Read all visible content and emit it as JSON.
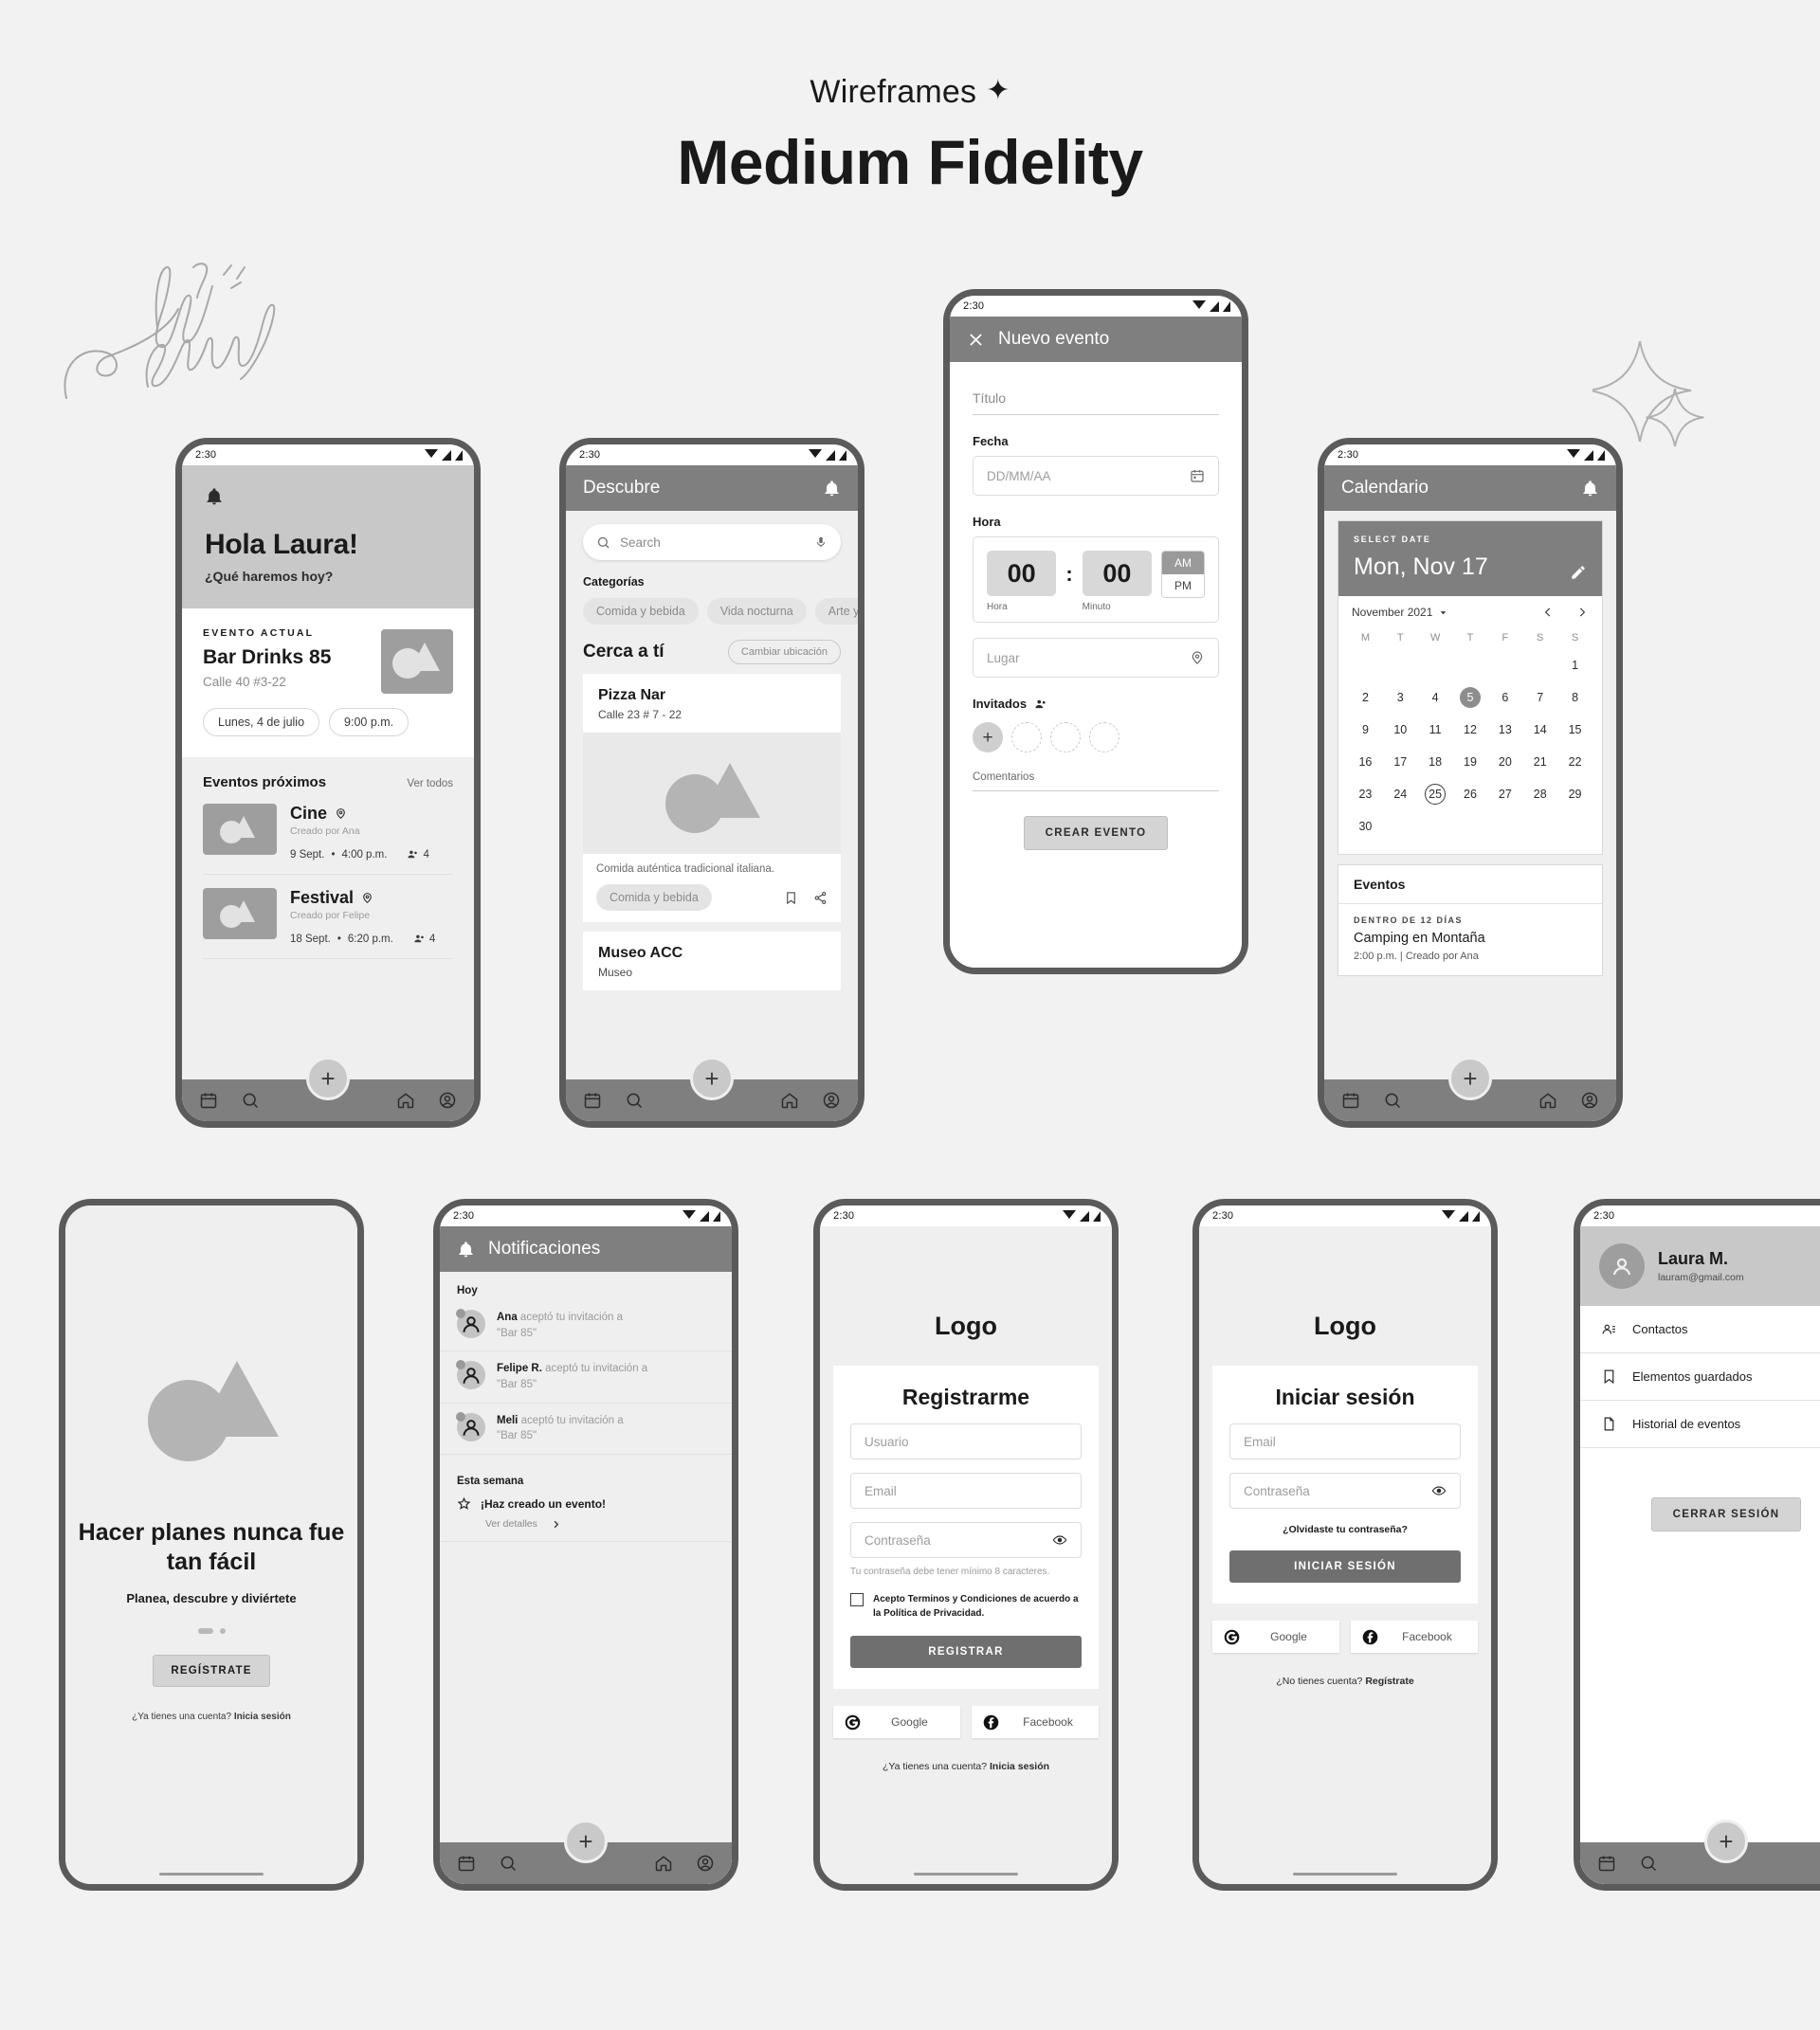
{
  "header": {
    "subtitle": "Wireframes",
    "star": "✦",
    "title": "Medium Fidelity"
  },
  "annotations": {
    "scribble": "home eventos"
  },
  "common": {
    "status_time": "2:30",
    "fab_label": "+",
    "nav": [
      "calendar-icon",
      "search-icon",
      "home-icon",
      "profile-icon"
    ]
  },
  "phone_home": {
    "bell": "bell-icon",
    "greeting": "Hola Laura!",
    "subgreeting": "¿Qué haremos hoy?",
    "current_event": {
      "kicker": "EVENTO ACTUAL",
      "title": "Bar Drinks 85",
      "address": "Calle 40 #3-22",
      "chips": [
        "Lunes, 4 de julio",
        "9:00 p.m."
      ]
    },
    "upcoming": {
      "title": "Eventos próximos",
      "see_all": "Ver todos",
      "items": [
        {
          "name": "Cine",
          "creator": "Creado por Ana",
          "date": "9 Sept.",
          "time": "4:00 p.m.",
          "guests": "4"
        },
        {
          "name": "Festival",
          "creator": "Creado por Felipe",
          "date": "18 Sept.",
          "time": "6:20 p.m.",
          "guests": "4"
        }
      ]
    }
  },
  "phone_discover": {
    "appbar_title": "Descubre",
    "search_placeholder": "Search",
    "categories_label": "Categorías",
    "categories": [
      "Comida y bebida",
      "Vida nocturna",
      "Arte y cultura"
    ],
    "near_title": "Cerca a tí",
    "change_location": "Cambiar ubicación",
    "places": [
      {
        "name": "Pizza Nar",
        "address": "Calle 23 # 7 - 22",
        "description": "Comida auténtica tradicional italiana.",
        "tag": "Comida y bebida"
      },
      {
        "name": "Museo ACC",
        "address": "Museo"
      }
    ]
  },
  "phone_new_event": {
    "appbar_title": "Nuevo evento",
    "close": "close-icon",
    "title_placeholder": "Título",
    "date_label": "Fecha",
    "date_placeholder": "DD/MM/AA",
    "time_label": "Hora",
    "hour_value": "00",
    "minute_value": "00",
    "hour_caption": "Hora",
    "minute_caption": "Minuto",
    "am": "AM",
    "pm": "PM",
    "place_placeholder": "Lugar",
    "guests_label": "Invitados",
    "comments_label": "Comentarios",
    "submit": "CREAR EVENTO"
  },
  "phone_calendar": {
    "appbar_title": "Calendario",
    "select_date_kicker": "SELECT DATE",
    "selected_date": "Mon, Nov 17",
    "month": "November 2021",
    "weekdays": [
      "M",
      "T",
      "W",
      "T",
      "F",
      "S",
      "S"
    ],
    "leading_blanks": 6,
    "days": [
      1,
      2,
      3,
      4,
      5,
      6,
      7,
      8,
      9,
      10,
      11,
      12,
      13,
      14,
      15,
      16,
      17,
      18,
      19,
      20,
      21,
      22,
      23,
      24,
      25,
      26,
      27,
      28,
      29,
      30
    ],
    "selected_day": 5,
    "today_day": 25,
    "events_title": "Eventos",
    "event": {
      "kicker": "DENTRO DE 12 DÍAS",
      "name": "Camping en Montaña",
      "meta": "2:00 p.m. | Creado por Ana"
    }
  },
  "phone_onboarding": {
    "headline": "Hacer planes nunca fue tan fácil",
    "sub": "Planea, descubre y diviértete",
    "cta": "REGÍSTRATE",
    "footer_plain": "¿Ya tienes una cuenta? ",
    "footer_bold": "Inicia sesión"
  },
  "phone_notifications": {
    "appbar_title": "Notificaciones",
    "bell": "bell-icon",
    "section_today": "Hoy",
    "section_week": "Esta semana",
    "items": [
      {
        "who": "Ana",
        "action": " aceptó tu invitación a",
        "target": "\"Bar 85\""
      },
      {
        "who": "Felipe R.",
        "action": " aceptó tu invitación a",
        "target": "\"Bar 85\""
      },
      {
        "who": "Meli",
        "action": " aceptó tu invitación a",
        "target": "\"Bar 85\""
      }
    ],
    "week_event": "¡Haz creado un evento!",
    "week_details": "Ver detalles"
  },
  "phone_signup": {
    "logo": "Logo",
    "title": "Registrarme",
    "user_placeholder": "Usuario",
    "email_placeholder": "Email",
    "password_placeholder": "Contraseña",
    "password_hint": "Tu contraseña debe tener mínimo 8 caracteres.",
    "terms": "Acepto Terminos y Condiciones de acuerdo a la Política de Privacidad.",
    "submit": "REGISTRAR",
    "google": "Google",
    "facebook": "Facebook",
    "footer_plain": "¿Ya tienes una cuenta? ",
    "footer_bold": "Inicia sesión"
  },
  "phone_login": {
    "logo": "Logo",
    "title": "Iniciar sesión",
    "email_placeholder": "Email",
    "password_placeholder": "Contraseña",
    "forgot": "¿Olvidaste tu contraseña?",
    "submit": "INICIAR SESIÓN",
    "google": "Google",
    "facebook": "Facebook",
    "footer_plain": "¿No tienes cuenta? ",
    "footer_bold": "Regístrate"
  },
  "phone_profile": {
    "name": "Laura M.",
    "email": "lauram@gmail.com",
    "items": [
      {
        "icon": "contacts-icon",
        "label": "Contactos"
      },
      {
        "icon": "bookmark-icon",
        "label": "Elementos guardados"
      },
      {
        "icon": "history-icon",
        "label": "Historial de eventos"
      }
    ],
    "logout": "CERRAR SESIÓN"
  }
}
